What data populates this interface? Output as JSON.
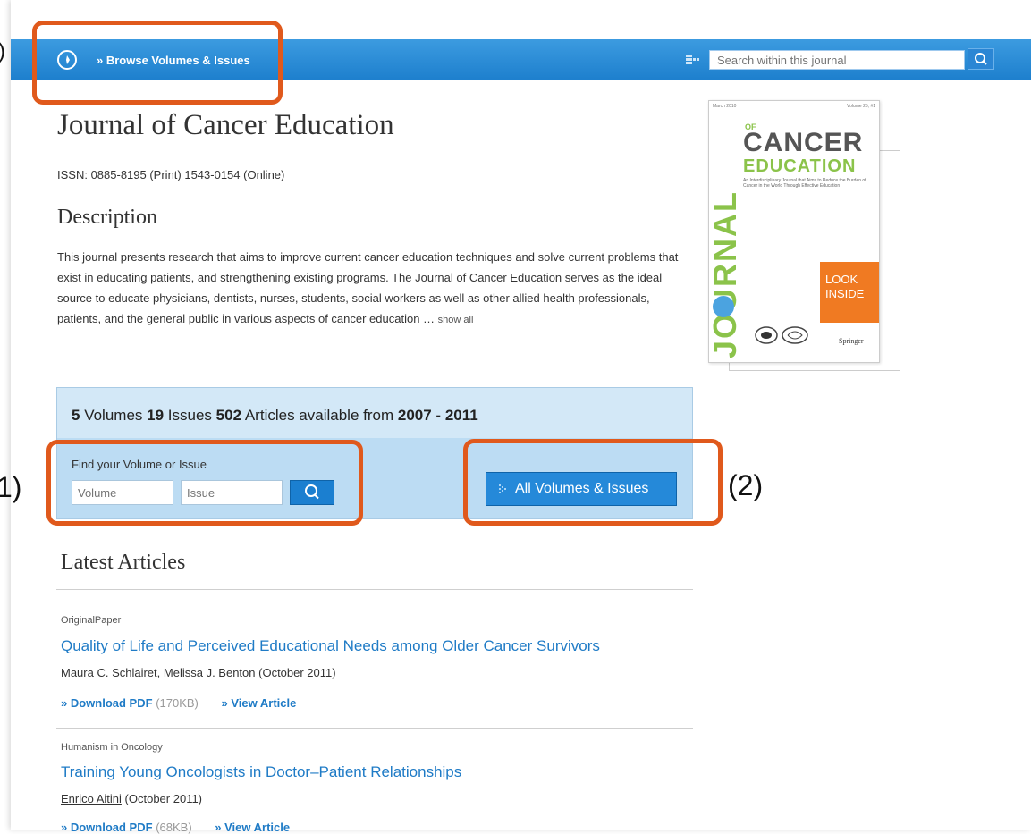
{
  "nav": {
    "browse_label": "» Browse Volumes & Issues",
    "search_placeholder": "Search within this journal"
  },
  "journal": {
    "title": "Journal of Cancer Education",
    "issn": "ISSN: 0885-8195 (Print) 1543-0154 (Online)"
  },
  "description": {
    "heading": "Description",
    "text": "This journal presents research that aims to improve current cancer education techniques and solve current problems that exist in educating patients, and strengthening existing programs. The Journal of Cancer Education serves as the ideal source to educate physicians, dentists, nurses, students, social workers as well as other allied health professionals, patients, and the general public in various aspects of cancer education …",
    "show_all": "show all"
  },
  "cover": {
    "top_left": "March 2010",
    "top_right": "Volume 25, #1",
    "vertical_word": "JOURNAL",
    "of": "OF",
    "cancer": "CANCER",
    "education": "EDUCATION",
    "subtitle": "An Interdisciplinary Journal that Aims to Reduce the Burden of Cancer in the World Through Effective Education",
    "look_inside": "LOOK INSIDE",
    "publisher": "Springer"
  },
  "volumes": {
    "volumes_count": "5",
    "volumes_word": "Volumes",
    "issues_count": "19",
    "issues_word": "Issues",
    "articles_count": "502",
    "articles_word": "Articles available from",
    "year_from": "2007",
    "dash": "-",
    "year_to": "2011",
    "find_label": "Find your Volume or Issue",
    "volume_placeholder": "Volume",
    "issue_placeholder": "Issue",
    "all_button": "All Volumes & Issues"
  },
  "annotations": {
    "label_1": "1)",
    "label_2": "(2)",
    "label_top": ")"
  },
  "latest": {
    "heading": "Latest Articles",
    "articles": [
      {
        "type": "OriginalPaper",
        "title": "Quality of Life and Perceived Educational Needs among Older Cancer Survivors",
        "author_1": "Maura C. Schlairet",
        "author_2": "Melissa J. Benton",
        "date": "(October 2011)",
        "download": "» Download PDF",
        "size": "(170KB)",
        "view": "» View Article"
      },
      {
        "type": "Humanism in Oncology",
        "title": "Training Young Oncologists in Doctor–Patient Relationships",
        "author_1": "Enrico Aitini",
        "date": "(October 2011)",
        "download": "» Download PDF",
        "size": "(68KB)",
        "view": "» View Article"
      }
    ]
  },
  "colors": {
    "nav_blue": "#1d7fcd",
    "link_blue": "#1f7bc6",
    "annotation_orange": "#e0591c",
    "box_blue": "#d3e8f7",
    "cover_orange": "#f07a22",
    "cover_green": "#8bc34a"
  }
}
